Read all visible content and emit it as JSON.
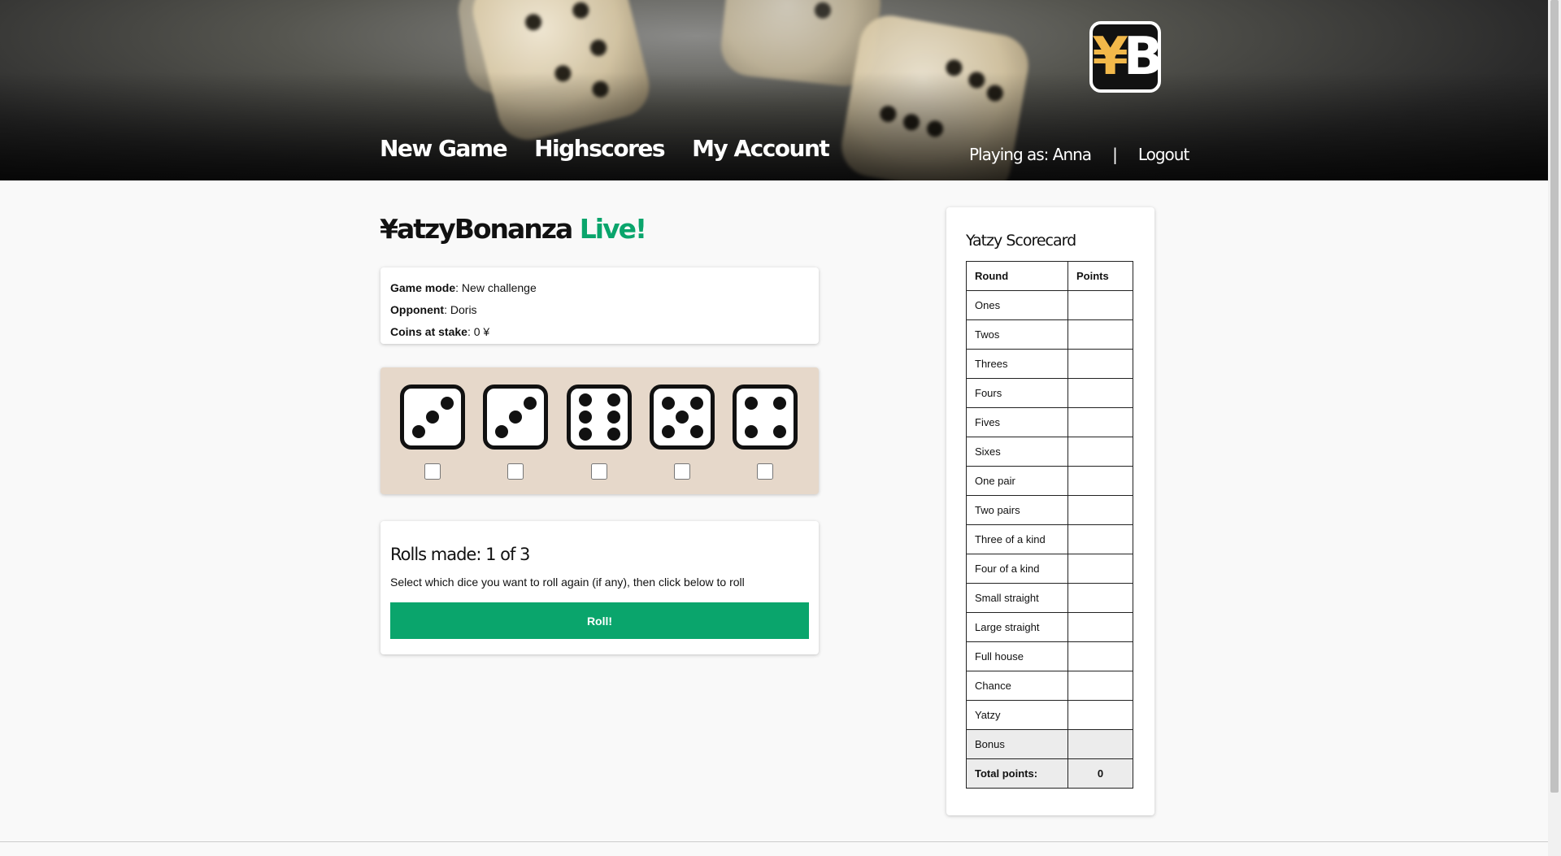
{
  "header": {
    "logo_text": "¥B",
    "nav": [
      "New Game",
      "Highscores",
      "My Account"
    ],
    "playing_as": "Playing as: Anna",
    "separator": "|",
    "logout": "Logout"
  },
  "main": {
    "title": "¥atzyBonanza",
    "title_live": "Live!",
    "info": {
      "mode_label": "Game mode",
      "mode_value": ": New challenge",
      "opponent_label": "Opponent",
      "opponent_value": ": Doris",
      "coins_label": "Coins at stake",
      "coins_value": ": 0 ¥"
    },
    "dice": [
      3,
      3,
      6,
      5,
      4
    ],
    "held": [
      false,
      false,
      false,
      false,
      false
    ],
    "rolls": {
      "title": "Rolls made: 1 of 3",
      "instruction": "Select which dice you want to roll again (if any), then click below to roll",
      "button": "Roll!"
    }
  },
  "scorecard": {
    "title": "Yatzy Scorecard",
    "headers": [
      "Round",
      "Points"
    ],
    "rows": [
      "Ones",
      "Twos",
      "Threes",
      "Fours",
      "Fives",
      "Sixes",
      "One pair",
      "Two pairs",
      "Three of a kind",
      "Four of a kind",
      "Small straight",
      "Large straight",
      "Full house",
      "Chance",
      "Yatzy"
    ],
    "bonus_label": "Bonus",
    "total_label": "Total points:",
    "total_value": "0"
  },
  "colors": {
    "accent": "#0aa56c",
    "dice_panel": "#e6d8ca",
    "logo_yen": "#f2b84a"
  }
}
